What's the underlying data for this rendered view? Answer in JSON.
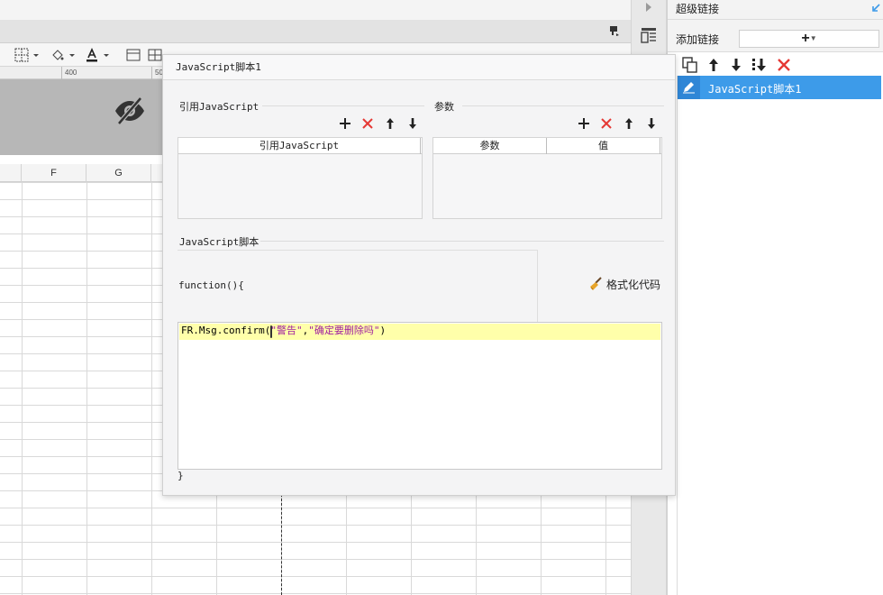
{
  "spreadsheet": {
    "ruler_labels": [
      "400",
      "50"
    ],
    "column_headers": [
      "F",
      "G"
    ]
  },
  "right_panel": {
    "title": "超级链接",
    "add_link_label": "添加链接",
    "add_button": "+",
    "items": [
      {
        "label": "JavaScript脚本1"
      }
    ]
  },
  "dialog": {
    "title": "JavaScript脚本1",
    "ref_section": {
      "label": "引用JavaScript",
      "table_header": "引用JavaScript"
    },
    "params_section": {
      "label": "参数",
      "headers": [
        "参数",
        "值"
      ]
    },
    "script_section": {
      "label": "JavaScript脚本",
      "function_header": "function(){",
      "code": {
        "prefix": "FR.Msg.confirm(",
        "arg1": "\"警告\"",
        "sep": ",",
        "arg2": "\"确定要删除吗\"",
        "suffix": ")"
      },
      "function_footer": "}",
      "format_button": "格式化代码"
    }
  },
  "colors": {
    "accent": "#3d9be9",
    "delete_red": "#e53935",
    "highlight_line": "#ffffaa",
    "string_purple": "#a020a0"
  }
}
